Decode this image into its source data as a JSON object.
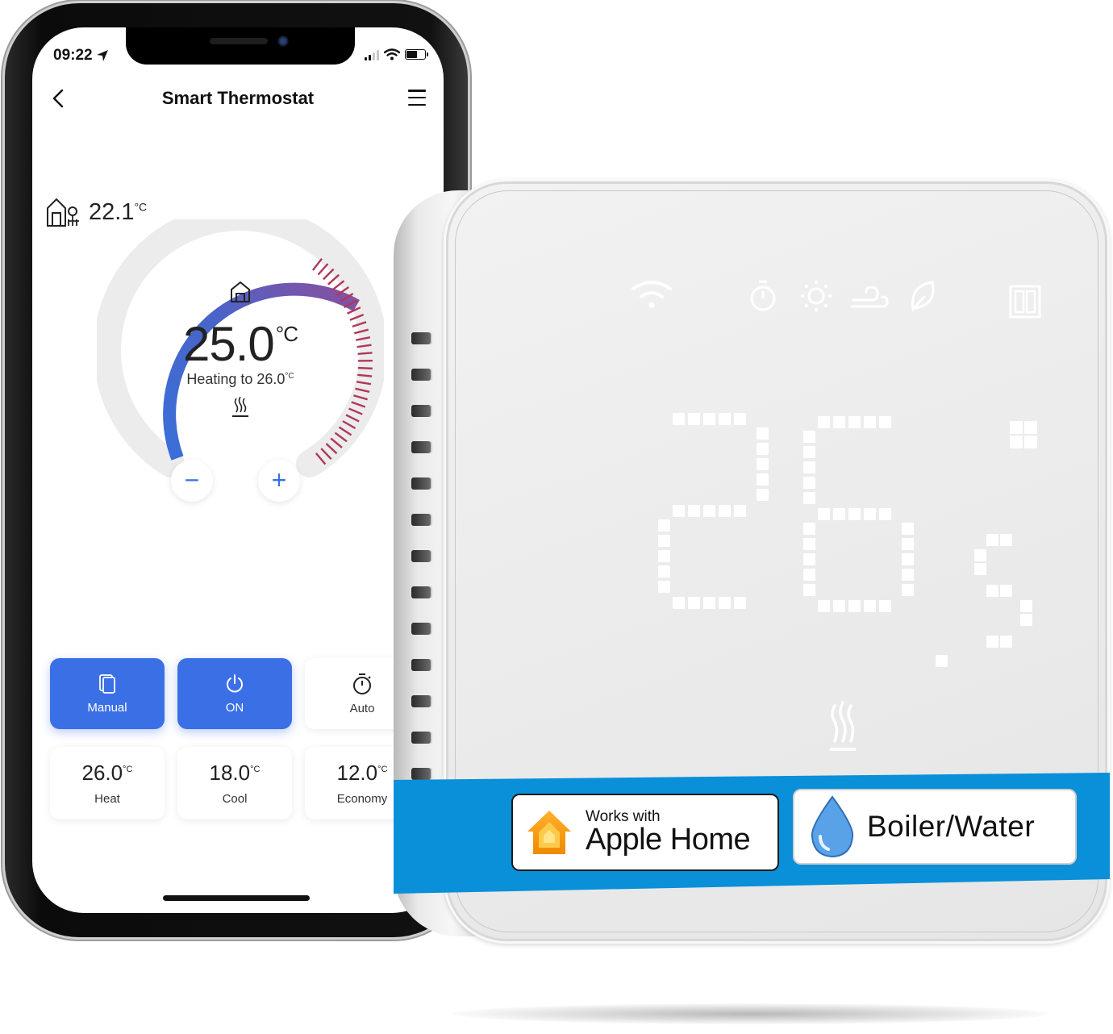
{
  "phone": {
    "status_bar": {
      "time": "09:22",
      "location_icon": "location-arrow-icon",
      "signal_icon": "cellular-signal-icon",
      "wifi_icon": "wifi-icon",
      "battery_icon": "battery-icon",
      "battery_level_fraction": 0.6
    },
    "nav": {
      "back_icon": "chevron-left-icon",
      "title": "Smart Thermostat",
      "menu_icon": "hamburger-menu-icon"
    },
    "indoor": {
      "icon": "house-outdoor-icon",
      "value": "22.1",
      "unit": "°C"
    },
    "dial": {
      "home_icon": "house-icon",
      "current_temp": "25.0",
      "unit": "°C",
      "status_prefix": "Heating to 26.0",
      "status_unit": "°C",
      "heat_icon": "heating-icon",
      "minus_label": "−",
      "plus_label": "+",
      "gradient_start": "#3a6fd8",
      "gradient_end": "#8a4f9e",
      "tick_color": "#b0385a"
    },
    "modes": [
      {
        "label": "Manual",
        "icon": "manual-copy-icon",
        "active": true
      },
      {
        "label": "ON",
        "icon": "power-icon",
        "active": true
      },
      {
        "label": "Auto",
        "icon": "timer-icon",
        "active": false
      }
    ],
    "presets": [
      {
        "value": "26.0",
        "unit": "°C",
        "label": "Heat"
      },
      {
        "value": "18.0",
        "unit": "°C",
        "label": "Cool"
      },
      {
        "value": "12.0",
        "unit": "°C",
        "label": "Economy"
      }
    ],
    "accent_color": "#3b6fe6"
  },
  "device": {
    "icons": [
      "wifi-icon",
      "timer-icon",
      "sun-icon",
      "wind-icon",
      "leaf-icon",
      "window-icon"
    ],
    "display_value": "26.5",
    "display_unit_icon": "degree-icon",
    "heat_icon": "heating-icon",
    "banner_color": "#0a8fd9",
    "badges": {
      "apple": {
        "icon": "apple-home-icon",
        "small": "Works with",
        "big": "Apple Home"
      },
      "water": {
        "icon": "water-drop-icon",
        "big": "Boiler/Water"
      }
    }
  }
}
